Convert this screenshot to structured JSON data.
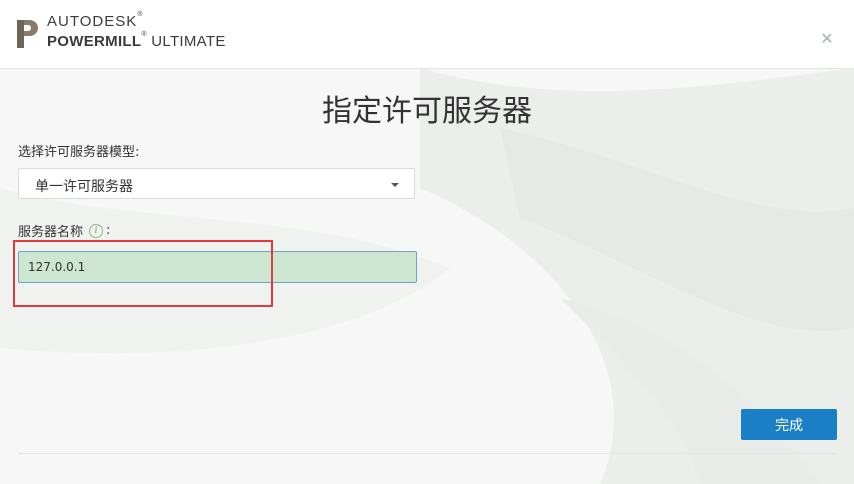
{
  "header": {
    "brand_line1": "AUTODESK",
    "brand_line1_mark": "®",
    "brand_product_bold": "POWERMILL",
    "brand_product_mark": "®",
    "brand_product_edition": " ULTIMATE",
    "close_glyph": "✕",
    "icon": "powermill-p-logo-icon"
  },
  "main": {
    "title": "指定许可服务器",
    "server_model_label": "选择许可服务器模型:",
    "server_model_selected": "单一许可服务器",
    "server_name_label": "服务器名称",
    "server_name_colon": ":",
    "info_glyph": "i",
    "server_name_value": "127.0.0.1"
  },
  "footer": {
    "finish_label": "完成"
  },
  "colors": {
    "accent": "#1b7fc6",
    "input_fill": "#cde6d2",
    "highlight_box": "#e23a3a"
  }
}
